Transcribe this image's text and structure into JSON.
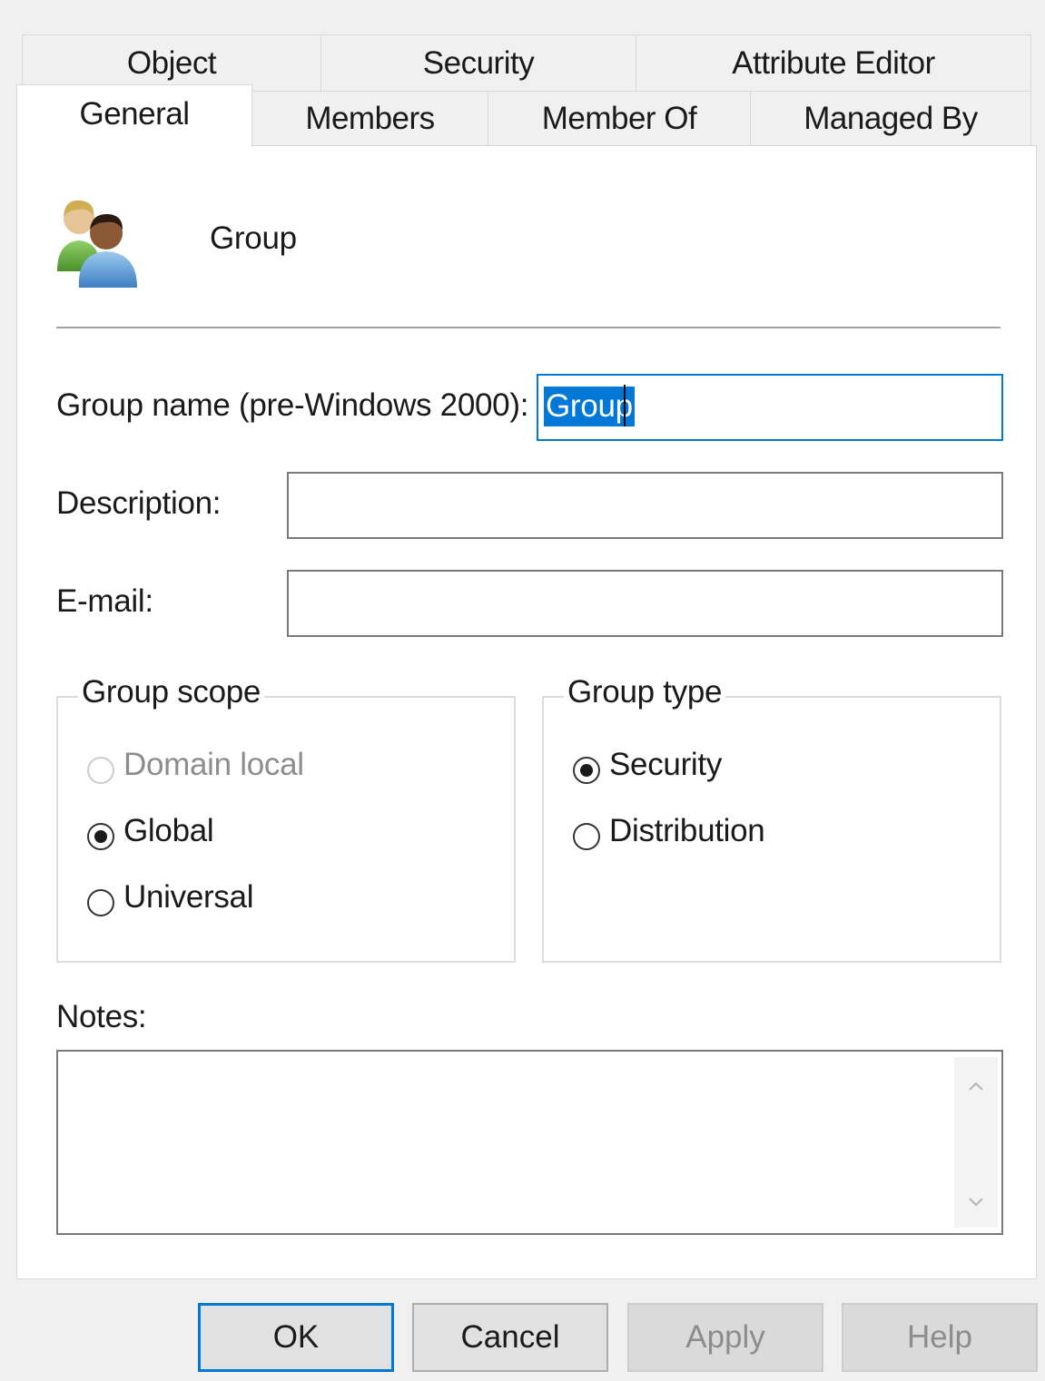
{
  "tabs_row1": [
    {
      "label": "Object"
    },
    {
      "label": "Security"
    },
    {
      "label": "Attribute Editor"
    }
  ],
  "tabs_row2": [
    {
      "label": "General",
      "active": true
    },
    {
      "label": "Members"
    },
    {
      "label": "Member Of"
    },
    {
      "label": "Managed By"
    }
  ],
  "header": {
    "icon": "users-group-icon",
    "title": "Group"
  },
  "form": {
    "group_name_label": "Group name (pre-Windows 2000):",
    "group_name_value": "Group",
    "description_label": "Description:",
    "description_value": "",
    "email_label": "E-mail:",
    "email_value": ""
  },
  "group_scope": {
    "title": "Group scope",
    "options": [
      {
        "label": "Domain local",
        "checked": false,
        "disabled": true
      },
      {
        "label": "Global",
        "checked": true,
        "disabled": false
      },
      {
        "label": "Universal",
        "checked": false,
        "disabled": false
      }
    ]
  },
  "group_type": {
    "title": "Group type",
    "options": [
      {
        "label": "Security",
        "checked": true
      },
      {
        "label": "Distribution",
        "checked": false
      }
    ]
  },
  "notes": {
    "label": "Notes:",
    "value": ""
  },
  "buttons": {
    "ok": "OK",
    "cancel": "Cancel",
    "apply": "Apply",
    "help": "Help"
  },
  "colors": {
    "accent": "#0078d7",
    "background": "#f0f0f0",
    "panel": "#ffffff"
  }
}
